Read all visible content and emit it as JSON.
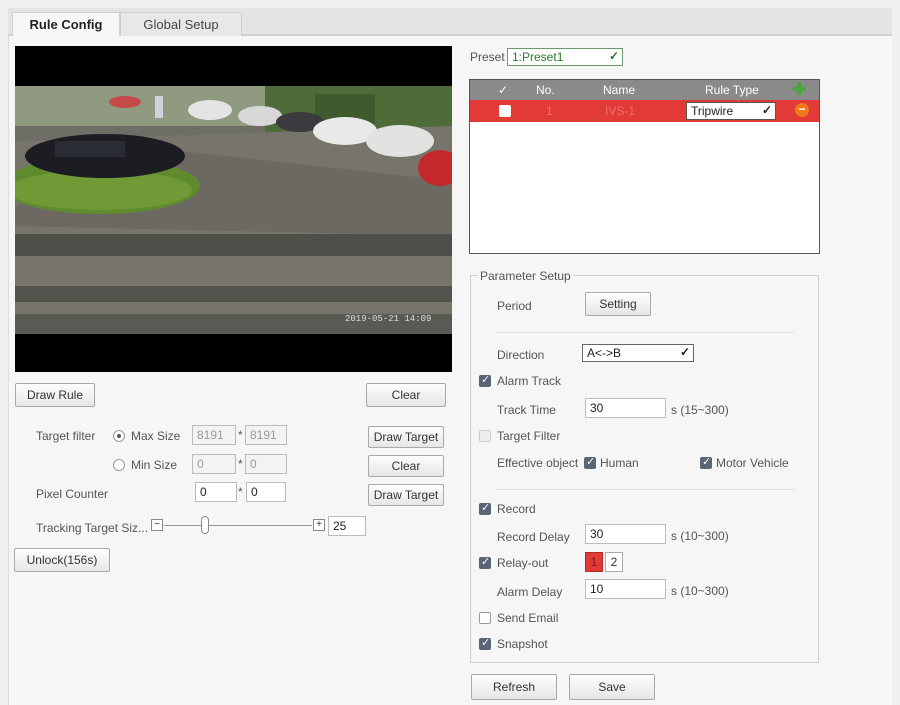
{
  "tabs": [
    {
      "label": "Rule Config",
      "active": true
    },
    {
      "label": "Global Setup",
      "active": false
    }
  ],
  "video": {
    "overlay_top": "...",
    "timestamp": "2019-05-21 14:09"
  },
  "left_controls": {
    "draw_rule": "Draw Rule",
    "clear_1": "Clear",
    "target_filter_label": "Target filter",
    "max_size_label": "Max Size",
    "max_w": "8191",
    "max_h": "8191",
    "min_size_label": "Min Size",
    "min_w": "0",
    "min_h": "0",
    "draw_target_1": "Draw Target",
    "clear_2": "Clear",
    "pixel_counter_label": "Pixel Counter",
    "pixel_w": "0",
    "pixel_h": "0",
    "draw_target_2": "Draw Target",
    "tracking_label": "Tracking Target Siz...",
    "tracking_value": "25",
    "tracking_level": 0.28,
    "unlock": "Unlock(156s)",
    "times": "*"
  },
  "preset": {
    "label": "Preset",
    "value": "1:Preset1"
  },
  "rule_table": {
    "headers": {
      "check": "✓",
      "no": "No.",
      "name": "Name",
      "type": "Rule Type"
    },
    "rows": [
      {
        "no": "1",
        "name": "IVS-1",
        "type": "Tripwire",
        "checked": true
      }
    ]
  },
  "params": {
    "legend": "Parameter Setup",
    "period_label": "Period",
    "setting_btn": "Setting",
    "direction_label": "Direction",
    "direction_value": "A<->B",
    "alarm_track_label": "Alarm Track",
    "track_time_label": "Track Time",
    "track_time_value": "30",
    "track_time_range": "s (15~300)",
    "target_filter_label": "Target Filter",
    "effective_object_label": "Effective object",
    "human_label": "Human",
    "motor_label": "Motor Vehicle",
    "record_label": "Record",
    "record_delay_label": "Record Delay",
    "record_delay_value": "30",
    "record_delay_range": "s (10~300)",
    "relay_label": "Relay-out",
    "relay_1": "1",
    "relay_2": "2",
    "alarm_delay_label": "Alarm Delay",
    "alarm_delay_value": "10",
    "alarm_delay_range": "s (10~300)",
    "send_email_label": "Send Email",
    "snapshot_label": "Snapshot"
  },
  "footer": {
    "refresh": "Refresh",
    "save": "Save"
  },
  "colors": {
    "row_selected": "#e23a36",
    "header_bg": "#8a8a8a",
    "add_icon": "#47a83a",
    "remove_icon": "#f07a1a"
  }
}
